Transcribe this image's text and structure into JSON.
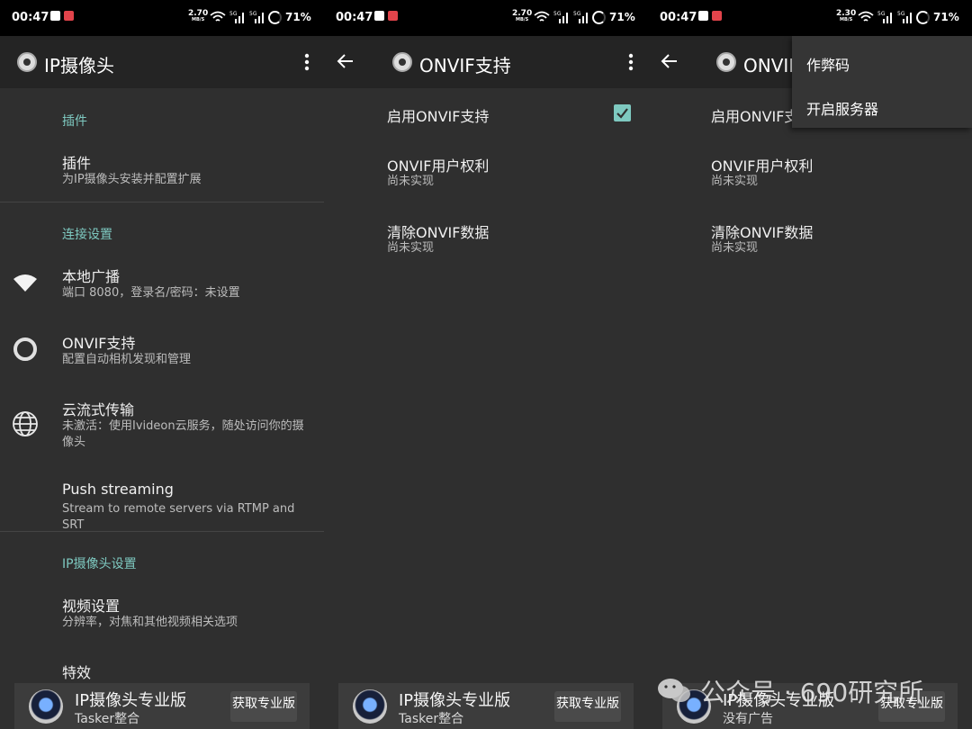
{
  "status": {
    "time": "00:47",
    "speed1": "2.70",
    "speed2": "2.30",
    "speed_unit": "MB/S",
    "network": "5G",
    "battery": "71%"
  },
  "screen1": {
    "title": "IP摄像头",
    "sections": {
      "plugins": "插件",
      "connection": "连接设置",
      "camera": "IP摄像头设置"
    },
    "items": [
      {
        "title": "插件",
        "subtitle": "为IP摄像头安装并配置扩展"
      },
      {
        "title": "本地广播",
        "subtitle": "端口 8080，登录名/密码：未设置",
        "icon": "wifi-icon"
      },
      {
        "title": "ONVIF支持",
        "subtitle": "配置自动相机发现和管理",
        "icon": "ring-icon"
      },
      {
        "title": "云流式传输",
        "subtitle": "未激活：使用Ivideon云服务，随处访问你的摄像头",
        "icon": "globe-icon"
      },
      {
        "title": "Push streaming",
        "subtitle": "Stream to remote servers via RTMP and SRT"
      },
      {
        "title": "视频设置",
        "subtitle": "分辨率，对焦和其他视频相关选项"
      },
      {
        "title": "特效",
        "subtitle": ""
      }
    ]
  },
  "screen2": {
    "title": "ONVIF支持",
    "items": [
      {
        "title": "启用ONVIF支持",
        "subtitle": "",
        "checked": true
      },
      {
        "title": "ONVIF用户权利",
        "subtitle": "尚未实现"
      },
      {
        "title": "清除ONVIF数据",
        "subtitle": "尚未实现"
      }
    ]
  },
  "screen3": {
    "title": "ONVIF支持",
    "items": [
      {
        "title": "启用ONVIF支持",
        "subtitle": ""
      },
      {
        "title": "ONVIF用户权利",
        "subtitle": "尚未实现"
      },
      {
        "title": "清除ONVIF数据",
        "subtitle": "尚未实现"
      }
    ],
    "menu": [
      "作弊码",
      "开启服务器"
    ]
  },
  "ads": [
    {
      "title": "IP摄像头专业版",
      "subtitle": "Tasker整合",
      "button": "获取专业版"
    },
    {
      "title": "IP摄像头专业版",
      "subtitle": "Tasker整合",
      "button": "获取专业版"
    },
    {
      "title": "IP摄像头专业版",
      "subtitle": "没有广告",
      "button": "获取专业版"
    }
  ],
  "watermark": "公众号 · 690研究所",
  "colors": {
    "accent": "#7ec9c0",
    "background": "#2f2f2f",
    "appbar": "#242424",
    "statusbar": "#000000"
  }
}
